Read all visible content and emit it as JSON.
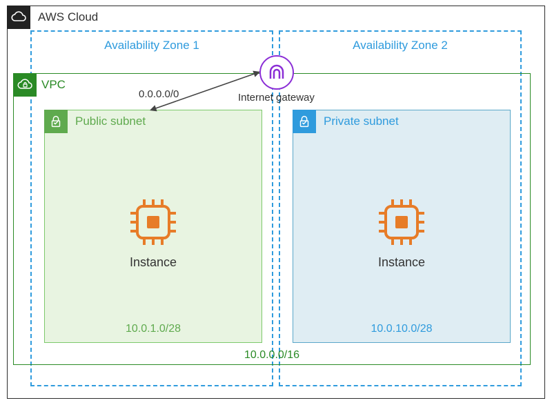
{
  "cloud": {
    "title": "AWS Cloud"
  },
  "az1": {
    "title": "Availability Zone 1"
  },
  "az2": {
    "title": "Availability Zone 2"
  },
  "vpc": {
    "title": "VPC",
    "cidr": "10.0.0.0/16"
  },
  "public_subnet": {
    "title": "Public subnet",
    "cidr": "10.0.1.0/28",
    "instance_label": "Instance"
  },
  "private_subnet": {
    "title": "Private subnet",
    "cidr": "10.0.10.0/28",
    "instance_label": "Instance"
  },
  "igw": {
    "label": "Internet gateway"
  },
  "route": {
    "cidr": "0.0.0.0/0"
  }
}
